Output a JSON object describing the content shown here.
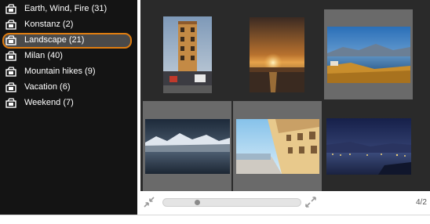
{
  "albums": [
    {
      "label": "Earth, Wind, Fire (31)",
      "icon": "album-icon",
      "selected": false
    },
    {
      "label": "Konstanz (2)",
      "icon": "album-icon",
      "selected": false
    },
    {
      "label": "Landscape (21)",
      "icon": "album-icon",
      "selected": true
    },
    {
      "label": "Milan (40)",
      "icon": "album-icon",
      "selected": false
    },
    {
      "label": "Mountain hikes (9)",
      "icon": "album-icon",
      "selected": false
    },
    {
      "label": "Vacation (6)",
      "icon": "album-icon",
      "selected": false
    },
    {
      "label": "Weekend (7)",
      "icon": "album-icon",
      "selected": false
    }
  ],
  "thumbnails": [
    {
      "subject": "tall building",
      "highlighted": false
    },
    {
      "subject": "lake sunset",
      "highlighted": false
    },
    {
      "subject": "lake panorama",
      "highlighted": true
    },
    {
      "subject": "mountain lake",
      "highlighted": true
    },
    {
      "subject": "street facades",
      "highlighted": true
    },
    {
      "subject": "lake at night",
      "highlighted": false
    }
  ],
  "footer": {
    "page_counter": "4/2",
    "zoom_level": 0.24
  },
  "colors": {
    "sidebar_bg": "#141414",
    "selection_outline": "#e07d10",
    "selection_fill": "#4a4a4a",
    "thumb_pane_bg": "#2a2a2a",
    "thumb_highlight": "#6a6a6a"
  }
}
